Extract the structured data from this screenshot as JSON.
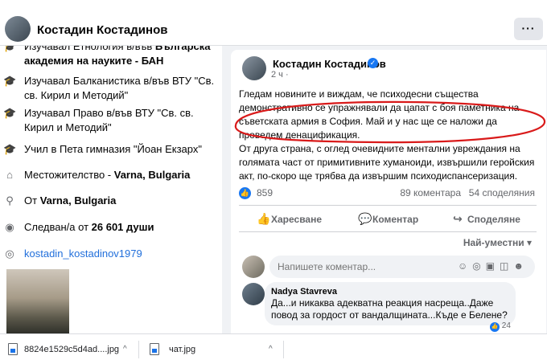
{
  "topbar": {
    "profile_name": "Костадин Костадинов",
    "more_label": "···"
  },
  "intro": {
    "study1_prefix": "Изучавал Етнология в/във ",
    "study1_place": "Българска академия на науките - БАН",
    "study2": "Изучавал Балканистика в/във ВТУ \"Св. св. Кирил и Методий\"",
    "study3": "Изучавал Право в/във ВТУ \"Св. св. Кирил и Методий\"",
    "school": "Учил в Пета гимназия \"Йоан Екзарх\"",
    "residence_prefix": "Местожителство - ",
    "residence_place": "Varna, Bulgaria",
    "from_prefix": "От ",
    "from_place": "Varna, Bulgaria",
    "followers_prefix": "Следван/а от ",
    "followers_count": "26 601 души",
    "instagram": "kostadin_kostadinov1979"
  },
  "post": {
    "author": "Костадин Костадинов",
    "time": "2 ч ·",
    "paragraph1": "Гледам новините и виждам, че психодесни същества демонстративно се упражнявали да цапат с боя паметника на съветската армия в София. Май и у нас ще се наложи да проведем денацификация.",
    "paragraph2": "От друга страна, с оглед очевидните ментални увреждания на голямата част от примитивните хуманоиди, извършили геройския акт, по-скоро ще трябва да извършим психодиспансеризация.",
    "likes": "859",
    "comments": "89 коментара",
    "shares": "54 споделяния",
    "like_label": "Харесване",
    "comment_label": "Коментар",
    "share_label": "Споделяне",
    "sort_label": "Най-уместни ▾",
    "comment_placeholder": "Напишете коментар...",
    "reply": {
      "name": "Nadya Stavreva",
      "text": "Да...и никаква адекватна реакция насреща..Даже повод за гордост от вандалщината...Къде е Белене?",
      "likes": "24"
    }
  },
  "downloads": [
    {
      "name": "8824e1529c5d4ad....jpg"
    },
    {
      "name": "чат.jpg"
    }
  ],
  "colors": {
    "accent": "#1877f2",
    "annotation": "#d91a1a"
  },
  "icons": [
    "graduation-cap-icon",
    "home-icon",
    "location-pin-icon",
    "rss-icon",
    "instagram-icon",
    "thumbs-up-icon",
    "comment-icon",
    "share-icon",
    "file-icon",
    "chevron-up-icon"
  ]
}
